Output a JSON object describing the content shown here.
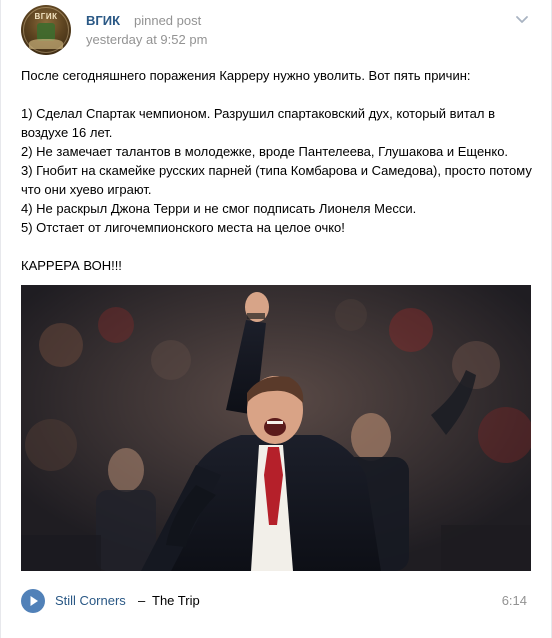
{
  "post": {
    "author": "ВГИК",
    "pinned_label": "pinned post",
    "time": "yesterday at 9:52 pm",
    "avatar_text": "ВГИК",
    "text": "После сегодняшнего поражения Карреру нужно уволить. Вот пять причин:\n\n1) Сделал Спартак чемпионом. Разрушил спартаковский дух, который витал в воздухе 16 лет.\n2) Не замечает талантов в молодежке, вроде Пантелеева, Глушакова и Ещенко.\n3) Гнобит на скамейке русских парней (типа Комбарова и Самедова), просто потому что они хуево играют.\n4) Не раскрыл Джона Терри и не смог подписать Лионеля Месси.\n5) Отстает от лигочемпионского места на целое очко!\n\nКАРРЕРА ВОН!!!"
  },
  "audio": {
    "artist": "Still Corners",
    "separator": "–",
    "title": "The Trip",
    "duration": "6:14"
  },
  "colors": {
    "link": "#2a5885",
    "muted": "#939393",
    "play": "#5181b8"
  },
  "icons": {
    "menu": "chevron-down-icon",
    "play": "play-icon"
  }
}
